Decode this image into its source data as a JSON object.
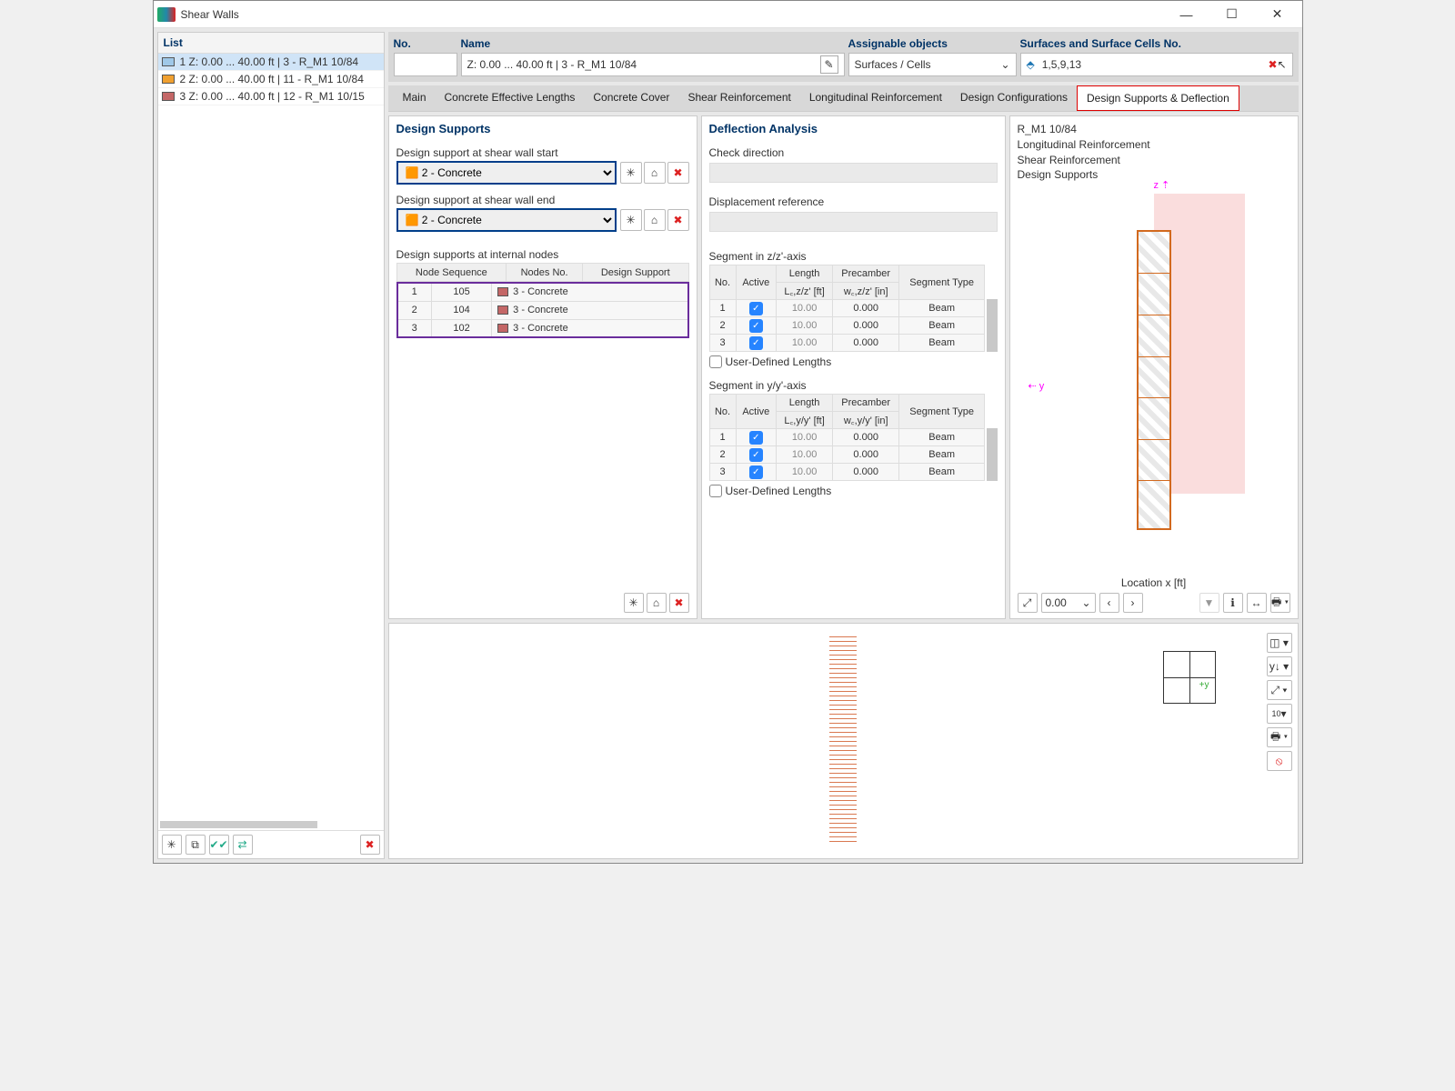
{
  "window": {
    "title": "Shear Walls"
  },
  "list": {
    "header": "List",
    "items": [
      {
        "num": "1",
        "text": "Z: 0.00 ... 40.00 ft | 3 - R_M1 10/84",
        "color": "#9fc8e8",
        "selected": true
      },
      {
        "num": "2",
        "text": "Z: 0.00 ... 40.00 ft | 11 - R_M1 10/84",
        "color": "#f0a030",
        "selected": false
      },
      {
        "num": "3",
        "text": "Z: 0.00 ... 40.00 ft | 12 - R_M1 10/15",
        "color": "#c46767",
        "selected": false
      }
    ]
  },
  "header": {
    "no_label": "No.",
    "name_label": "Name",
    "name_value": "Z: 0.00 ... 40.00  ft | 3 - R_M1 10/84",
    "ao_label": "Assignable objects",
    "ao_value": "Surfaces / Cells",
    "surf_label": "Surfaces and Surface Cells No.",
    "surf_value": "1,5,9,13"
  },
  "tabs": [
    "Main",
    "Concrete Effective Lengths",
    "Concrete Cover",
    "Shear Reinforcement",
    "Longitudinal Reinforcement",
    "Design Configurations",
    "Design Supports & Deflection"
  ],
  "ds": {
    "title": "Design Supports",
    "start_label": "Design support at shear wall start",
    "end_label": "Design support at shear wall end",
    "concrete2": "2 - Concrete",
    "internal_label": "Design supports at internal nodes",
    "th_seq": "Node Sequence",
    "th_no": "Nodes No.",
    "th_ds": "Design Support",
    "rows": [
      {
        "seq": "1",
        "no": "105",
        "ds": "3 - Concrete"
      },
      {
        "seq": "2",
        "no": "104",
        "ds": "3 - Concrete"
      },
      {
        "seq": "3",
        "no": "102",
        "ds": "3 - Concrete"
      }
    ]
  },
  "da": {
    "title": "Deflection Analysis",
    "check_dir": "Check direction",
    "disp_ref": "Displacement reference",
    "seg_z": "Segment in z/z'-axis",
    "seg_y": "Segment in y/y'-axis",
    "th_no": "No.",
    "th_active": "Active",
    "th_len_z": "Length L꜀,z/z' [ft]",
    "th_pre_z": "Precamber w꜀,z/z' [in]",
    "th_len_y": "Length L꜀,y/y' [ft]",
    "th_pre_y": "Precamber w꜀,y/y' [in]",
    "th_len_g": "Length",
    "th_pre_g": "Precamber",
    "th_type": "Segment Type",
    "rows": [
      {
        "no": "1",
        "len": "10.00",
        "pre": "0.000",
        "type": "Beam"
      },
      {
        "no": "2",
        "len": "10.00",
        "pre": "0.000",
        "type": "Beam"
      },
      {
        "no": "3",
        "len": "10.00",
        "pre": "0.000",
        "type": "Beam"
      }
    ],
    "udl": "User-Defined Lengths"
  },
  "pv": {
    "l1": "R_M1 10/84",
    "l2": "Longitudinal Reinforcement",
    "l3": "Shear Reinforcement",
    "l4": "Design Supports",
    "loc": "Location x [ft]",
    "val": "0.00"
  }
}
